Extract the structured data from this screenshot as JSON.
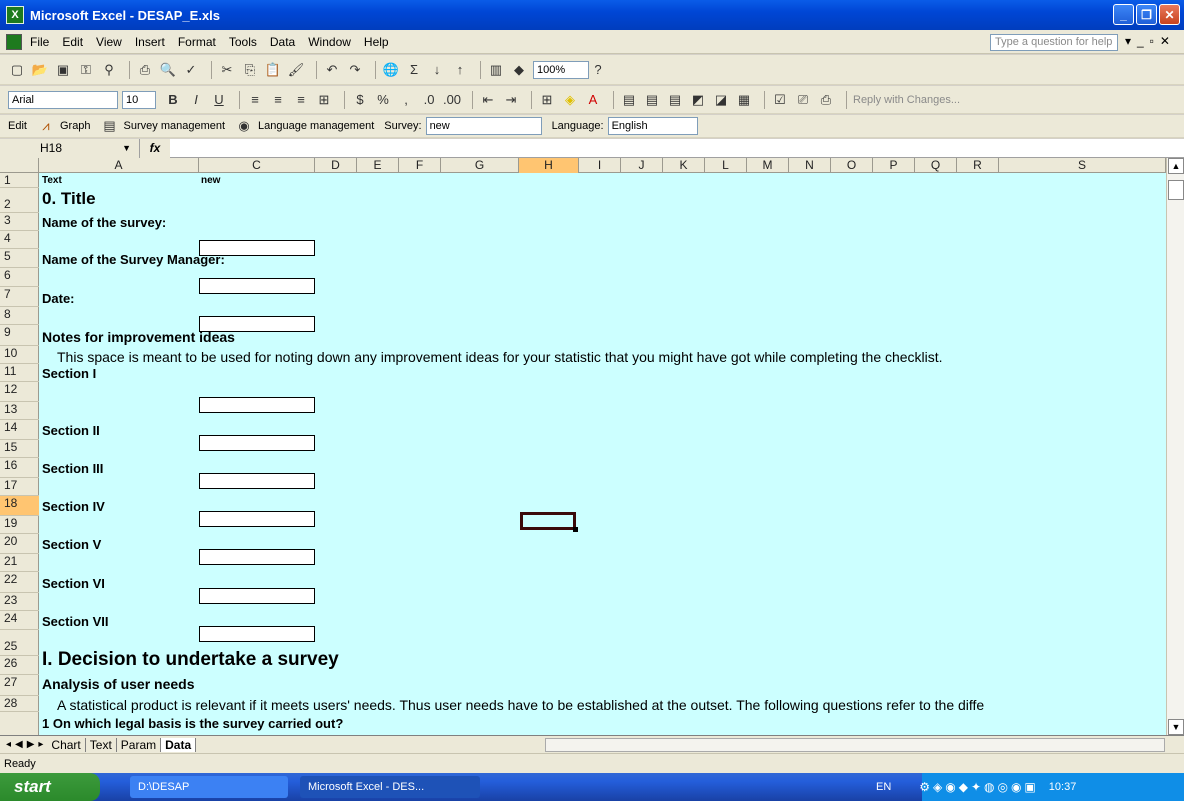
{
  "window": {
    "title": "Microsoft Excel - DESAP_E.xls"
  },
  "menu": {
    "items": [
      "File",
      "Edit",
      "View",
      "Insert",
      "Format",
      "Tools",
      "Data",
      "Window",
      "Help"
    ],
    "help_placeholder": "Type a question for help"
  },
  "standard_toolbar": {
    "zoom": "100%"
  },
  "format_toolbar": {
    "font": "Arial",
    "size": "10",
    "reply": "Reply with Changes..."
  },
  "custom_toolbar": {
    "edit": "Edit",
    "graph": "Graph",
    "survey_mgmt": "Survey management",
    "language_mgmt": "Language management",
    "survey_label": "Survey:",
    "survey_value": "new",
    "language_label": "Language:",
    "language_value": "English"
  },
  "formula": {
    "name_box": "H18",
    "fx": "fx",
    "value": ""
  },
  "columns": [
    "A",
    "C",
    "D",
    "E",
    "F",
    "G",
    "H",
    "I",
    "J",
    "K",
    "L",
    "M",
    "N",
    "O",
    "P",
    "Q",
    "R",
    "S"
  ],
  "rows": [
    "1",
    "2",
    "3",
    "4",
    "5",
    "6",
    "7",
    "8",
    "9",
    "10",
    "11",
    "12",
    "13",
    "14",
    "15",
    "16",
    "17",
    "18",
    "19",
    "20",
    "21",
    "22",
    "23",
    "24",
    "25",
    "26",
    "27",
    "28"
  ],
  "cells": {
    "r1a": "Text",
    "r1c": "new",
    "r2": "0. Title",
    "r3": "Name of the survey:",
    "r5": "Name of the Survey Manager:",
    "r7": "Date:",
    "r9": "Notes for improvement ideas",
    "r10": "This space is meant to be used for noting down any improvement ideas for your statistic that you might have got while completing the checklist.",
    "r11": "Section I",
    "r13": "Section II",
    "r15": "Section III",
    "r17": "Section IV",
    "r19": "Section V",
    "r21": "Section VI",
    "r23": "Section VII",
    "r25": "I. Decision to undertake a survey",
    "r26": "Analysis of user needs",
    "r27": "A statistical product is relevant if it meets users' needs. Thus user needs have to be established at the outset. The following questions refer to the diffe",
    "r28": "1 On which legal basis is the survey carried out?"
  },
  "sheet_tabs": [
    "Chart",
    "Text",
    "Param",
    "Data"
  ],
  "active_tab": "Data",
  "status": "Ready",
  "taskbar": {
    "start": "start",
    "task1": "D:\\DESAP",
    "task2": "Microsoft Excel - DES...",
    "lang": "EN",
    "clock": "10:37"
  }
}
